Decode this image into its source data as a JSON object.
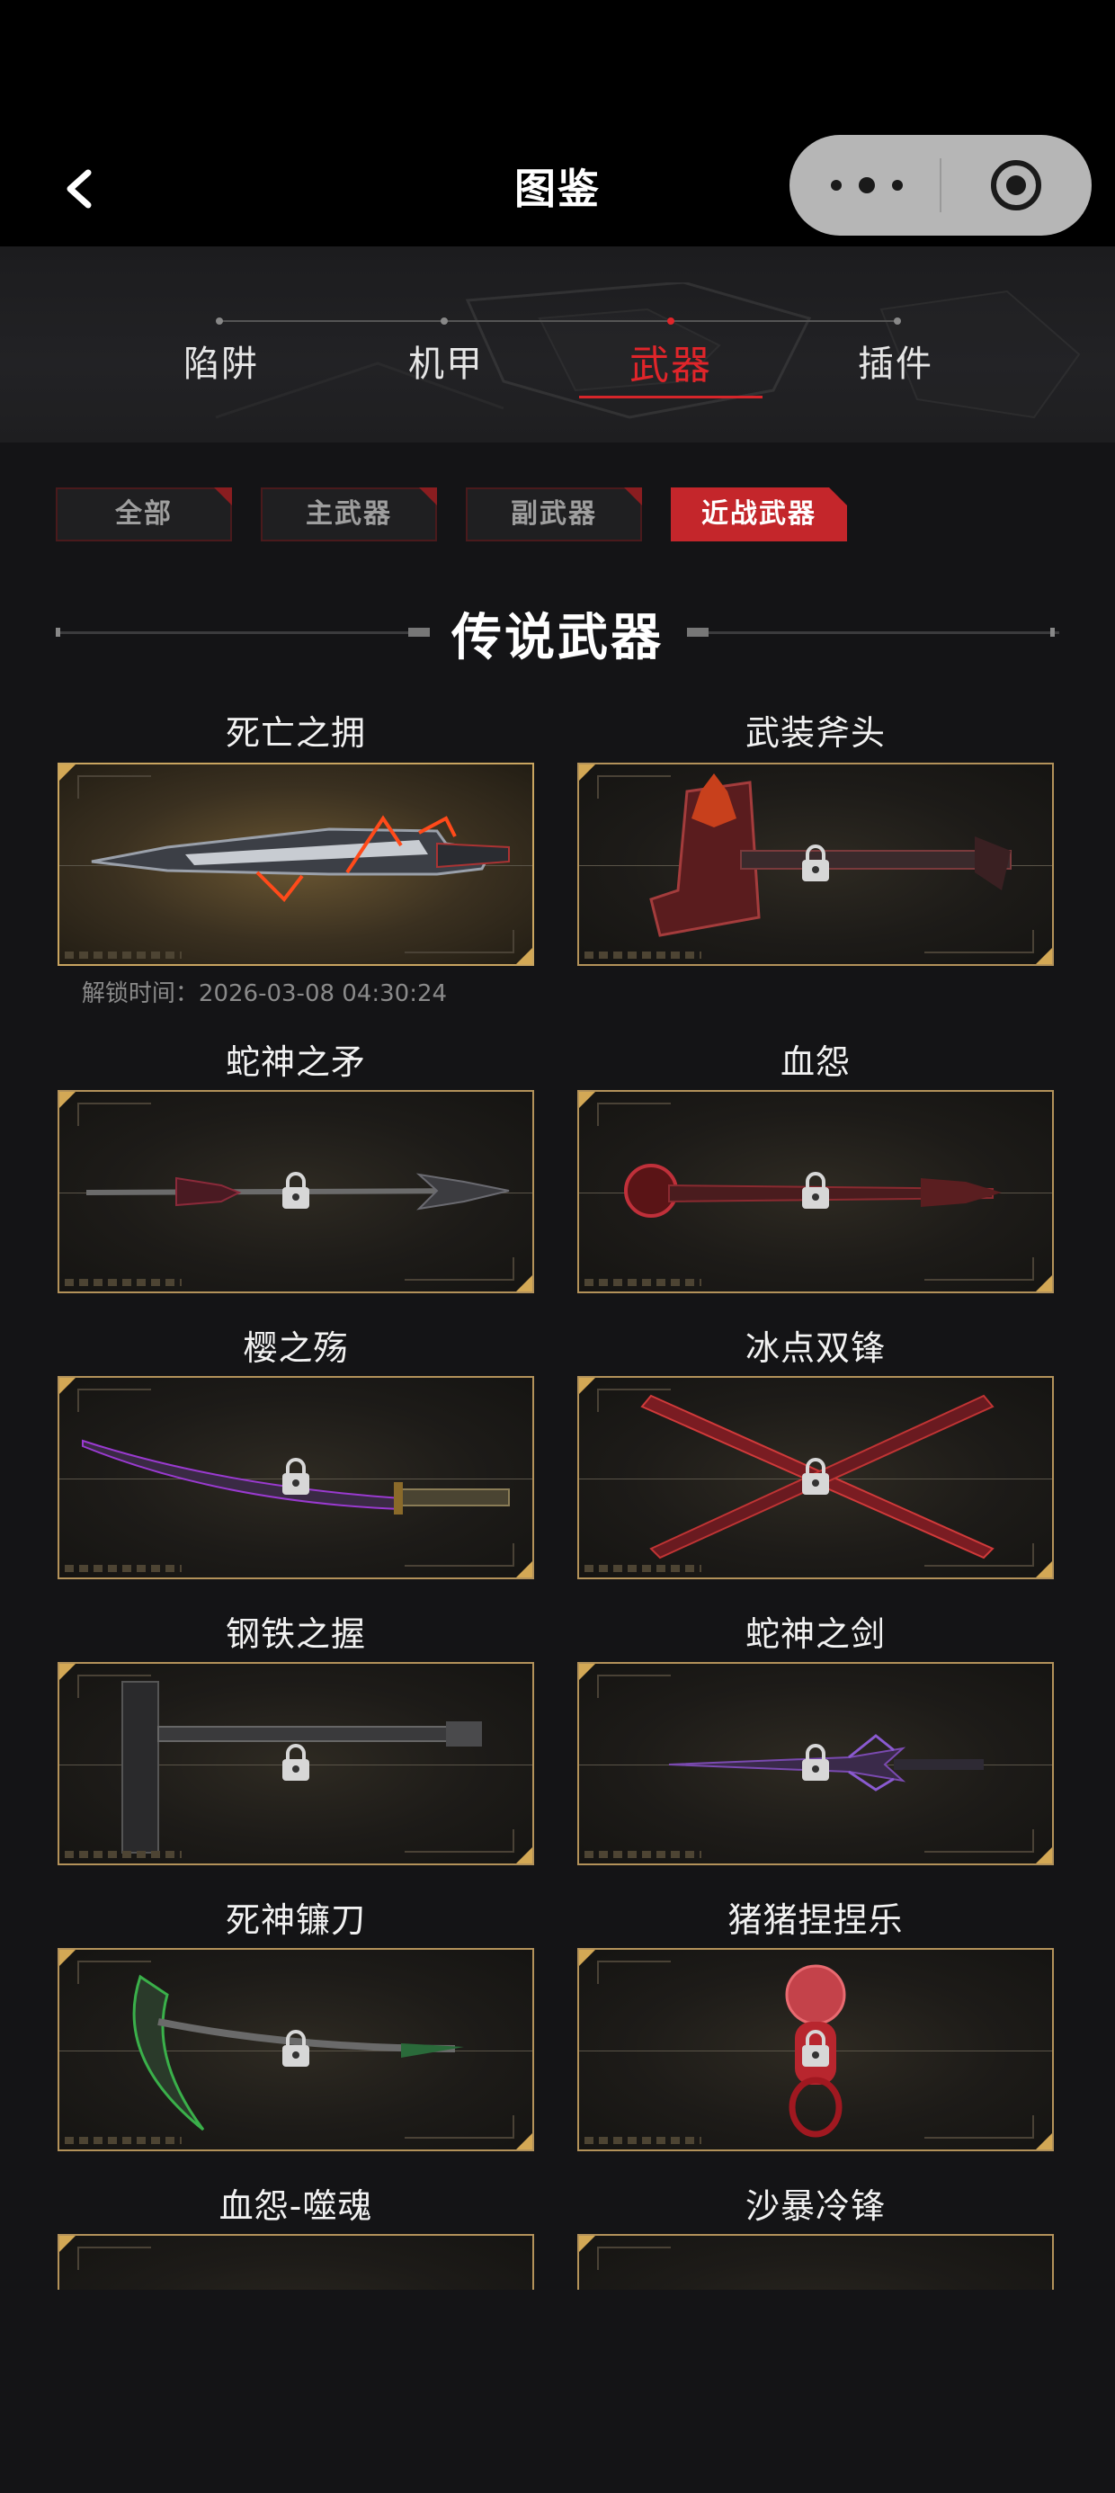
{
  "nav": {
    "title": "图鉴",
    "back_icon": "back-arrow-icon",
    "more_icon": "more-dots-icon",
    "close_icon": "target-circle-icon"
  },
  "tabs": [
    {
      "label": "陷阱",
      "active": false
    },
    {
      "label": "机甲",
      "active": false
    },
    {
      "label": "武器",
      "active": true
    },
    {
      "label": "插件",
      "active": false
    }
  ],
  "filters": [
    {
      "label": "全部",
      "active": false
    },
    {
      "label": "主武器",
      "active": false
    },
    {
      "label": "副武器",
      "active": false
    },
    {
      "label": "近战武器",
      "active": true
    }
  ],
  "section": {
    "title": "传说武器"
  },
  "items": [
    {
      "name": "死亡之拥",
      "locked": false,
      "unlock_time": "解锁时间：2026-03-08 04:30:24"
    },
    {
      "name": "武装斧头",
      "locked": true
    },
    {
      "name": "蛇神之矛",
      "locked": true
    },
    {
      "name": "血怨",
      "locked": true
    },
    {
      "name": "樱之殇",
      "locked": true
    },
    {
      "name": "冰点双锋",
      "locked": true
    },
    {
      "name": "钢铁之握",
      "locked": true
    },
    {
      "name": "蛇神之剑",
      "locked": true
    },
    {
      "name": "死神镰刀",
      "locked": true
    },
    {
      "name": "猪猪捏捏乐",
      "locked": true
    },
    {
      "name": "血怨-噬魂",
      "locked": true
    },
    {
      "name": "沙暴冷锋",
      "locked": true
    }
  ],
  "colors": {
    "accent_red": "#c4262b",
    "gold_border": "#b3925a",
    "background": "#141416"
  }
}
